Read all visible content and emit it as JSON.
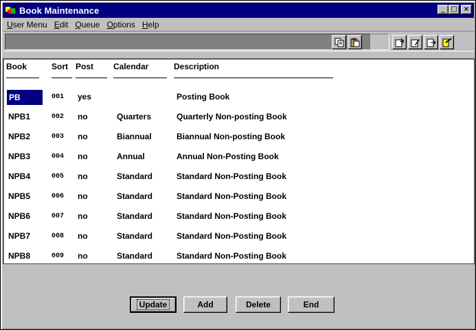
{
  "window": {
    "title": "Book Maintenance"
  },
  "titlebar": {
    "minimize": "_",
    "maximize": "□",
    "close": "×"
  },
  "menu": [
    {
      "label": "User Menu",
      "accel": "U",
      "rest": "ser Menu"
    },
    {
      "label": "Edit",
      "accel": "E",
      "rest": "dit"
    },
    {
      "label": "Queue",
      "accel": "Q",
      "rest": "ueue"
    },
    {
      "label": "Options",
      "accel": "O",
      "rest": "ptions"
    },
    {
      "label": "Help",
      "accel": "H",
      "rest": "elp"
    }
  ],
  "toolbar": {
    "icons": [
      "copy-icon",
      "paste-icon",
      "query-icon",
      "edit-query-icon",
      "export-icon",
      "exit-icon"
    ]
  },
  "grid": {
    "columns": [
      "Book",
      "Sort",
      "Post",
      "Calendar",
      "Description"
    ],
    "selected_row": 0,
    "rows": [
      {
        "book": "PB",
        "sort": "001",
        "post": "yes",
        "calendar": "",
        "description": "Posting Book"
      },
      {
        "book": "NPB1",
        "sort": "002",
        "post": "no",
        "calendar": "Quarters",
        "description": "Quarterly Non-posting Book"
      },
      {
        "book": "NPB2",
        "sort": "003",
        "post": "no",
        "calendar": "Biannual",
        "description": "Biannual Non-posting Book"
      },
      {
        "book": "NPB3",
        "sort": "004",
        "post": "no",
        "calendar": "Annual",
        "description": "Annual Non-Posting Book"
      },
      {
        "book": "NPB4",
        "sort": "005",
        "post": "no",
        "calendar": "Standard",
        "description": "Standard Non-Posting Book"
      },
      {
        "book": "NPB5",
        "sort": "006",
        "post": "no",
        "calendar": "Standard",
        "description": "Standard Non-Posting Book"
      },
      {
        "book": "NPB6",
        "sort": "007",
        "post": "no",
        "calendar": "Standard",
        "description": "Standard Non-Posting Book"
      },
      {
        "book": "NPB7",
        "sort": "008",
        "post": "no",
        "calendar": "Standard",
        "description": "Standard Non-Posting Book"
      },
      {
        "book": "NPB8",
        "sort": "009",
        "post": "no",
        "calendar": "Standard",
        "description": "Standard Non-Posting Book"
      }
    ]
  },
  "buttons": {
    "update": "Update",
    "add": "Add",
    "delete": "Delete",
    "end": "End"
  },
  "colors": {
    "titlebar": "#000080",
    "selection": "#000080",
    "face": "#c0c0c0"
  }
}
